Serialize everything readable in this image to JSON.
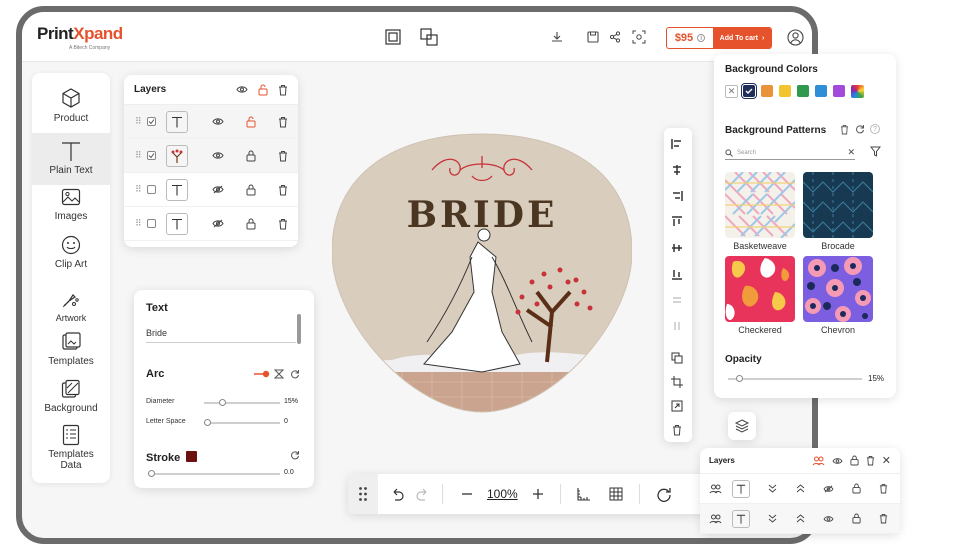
{
  "brand": {
    "name_a": "Print",
    "name_b": "Xpand",
    "tagline": "A Bitech Company"
  },
  "header": {
    "price": "$95",
    "add_to_cart": "Add To cart"
  },
  "tools": [
    {
      "label": "Product",
      "icon": "cube-icon"
    },
    {
      "label": "Plain Text",
      "icon": "text-icon"
    },
    {
      "label": "Images",
      "icon": "image-icon"
    },
    {
      "label": "Clip Art",
      "icon": "smiley-icon"
    },
    {
      "label": "Artwork",
      "icon": "palette-icon"
    },
    {
      "label": "Templates",
      "icon": "templates-icon"
    },
    {
      "label": "Background",
      "icon": "background-icon"
    },
    {
      "label": "Templates Data",
      "icon": "template-data-icon"
    }
  ],
  "layers_panel": {
    "title": "Layers"
  },
  "text_panel": {
    "text_label": "Text",
    "text_value": "Bride",
    "arc_label": "Arc",
    "diameter_label": "Diameter",
    "diameter_value": "15%",
    "diameter_level": 0.15,
    "letter_space_label": "Letter Space",
    "letter_space_value": "0",
    "stroke_label": "Stroke",
    "stroke_color": "#6b0f0f",
    "stroke_value": "0.0"
  },
  "canvas": {
    "artwork_text": "BRIDE",
    "zoom": "100%"
  },
  "background_panel": {
    "colors_title": "Background Colors",
    "colors": [
      "#1f2f5a",
      "#e8923a",
      "#f2c530",
      "#2f9a4d",
      "#2f8fd6",
      "#a24ad9"
    ],
    "patterns_title": "Background Patterns",
    "search_placeholder": "Search",
    "patterns": [
      "Basketweave",
      "Brocade",
      "Checkered",
      "Chevron"
    ],
    "opacity_label": "Opacity",
    "opacity_value": "15%",
    "opacity_level": 0.15
  },
  "layers_mini": {
    "title": "Layers"
  }
}
